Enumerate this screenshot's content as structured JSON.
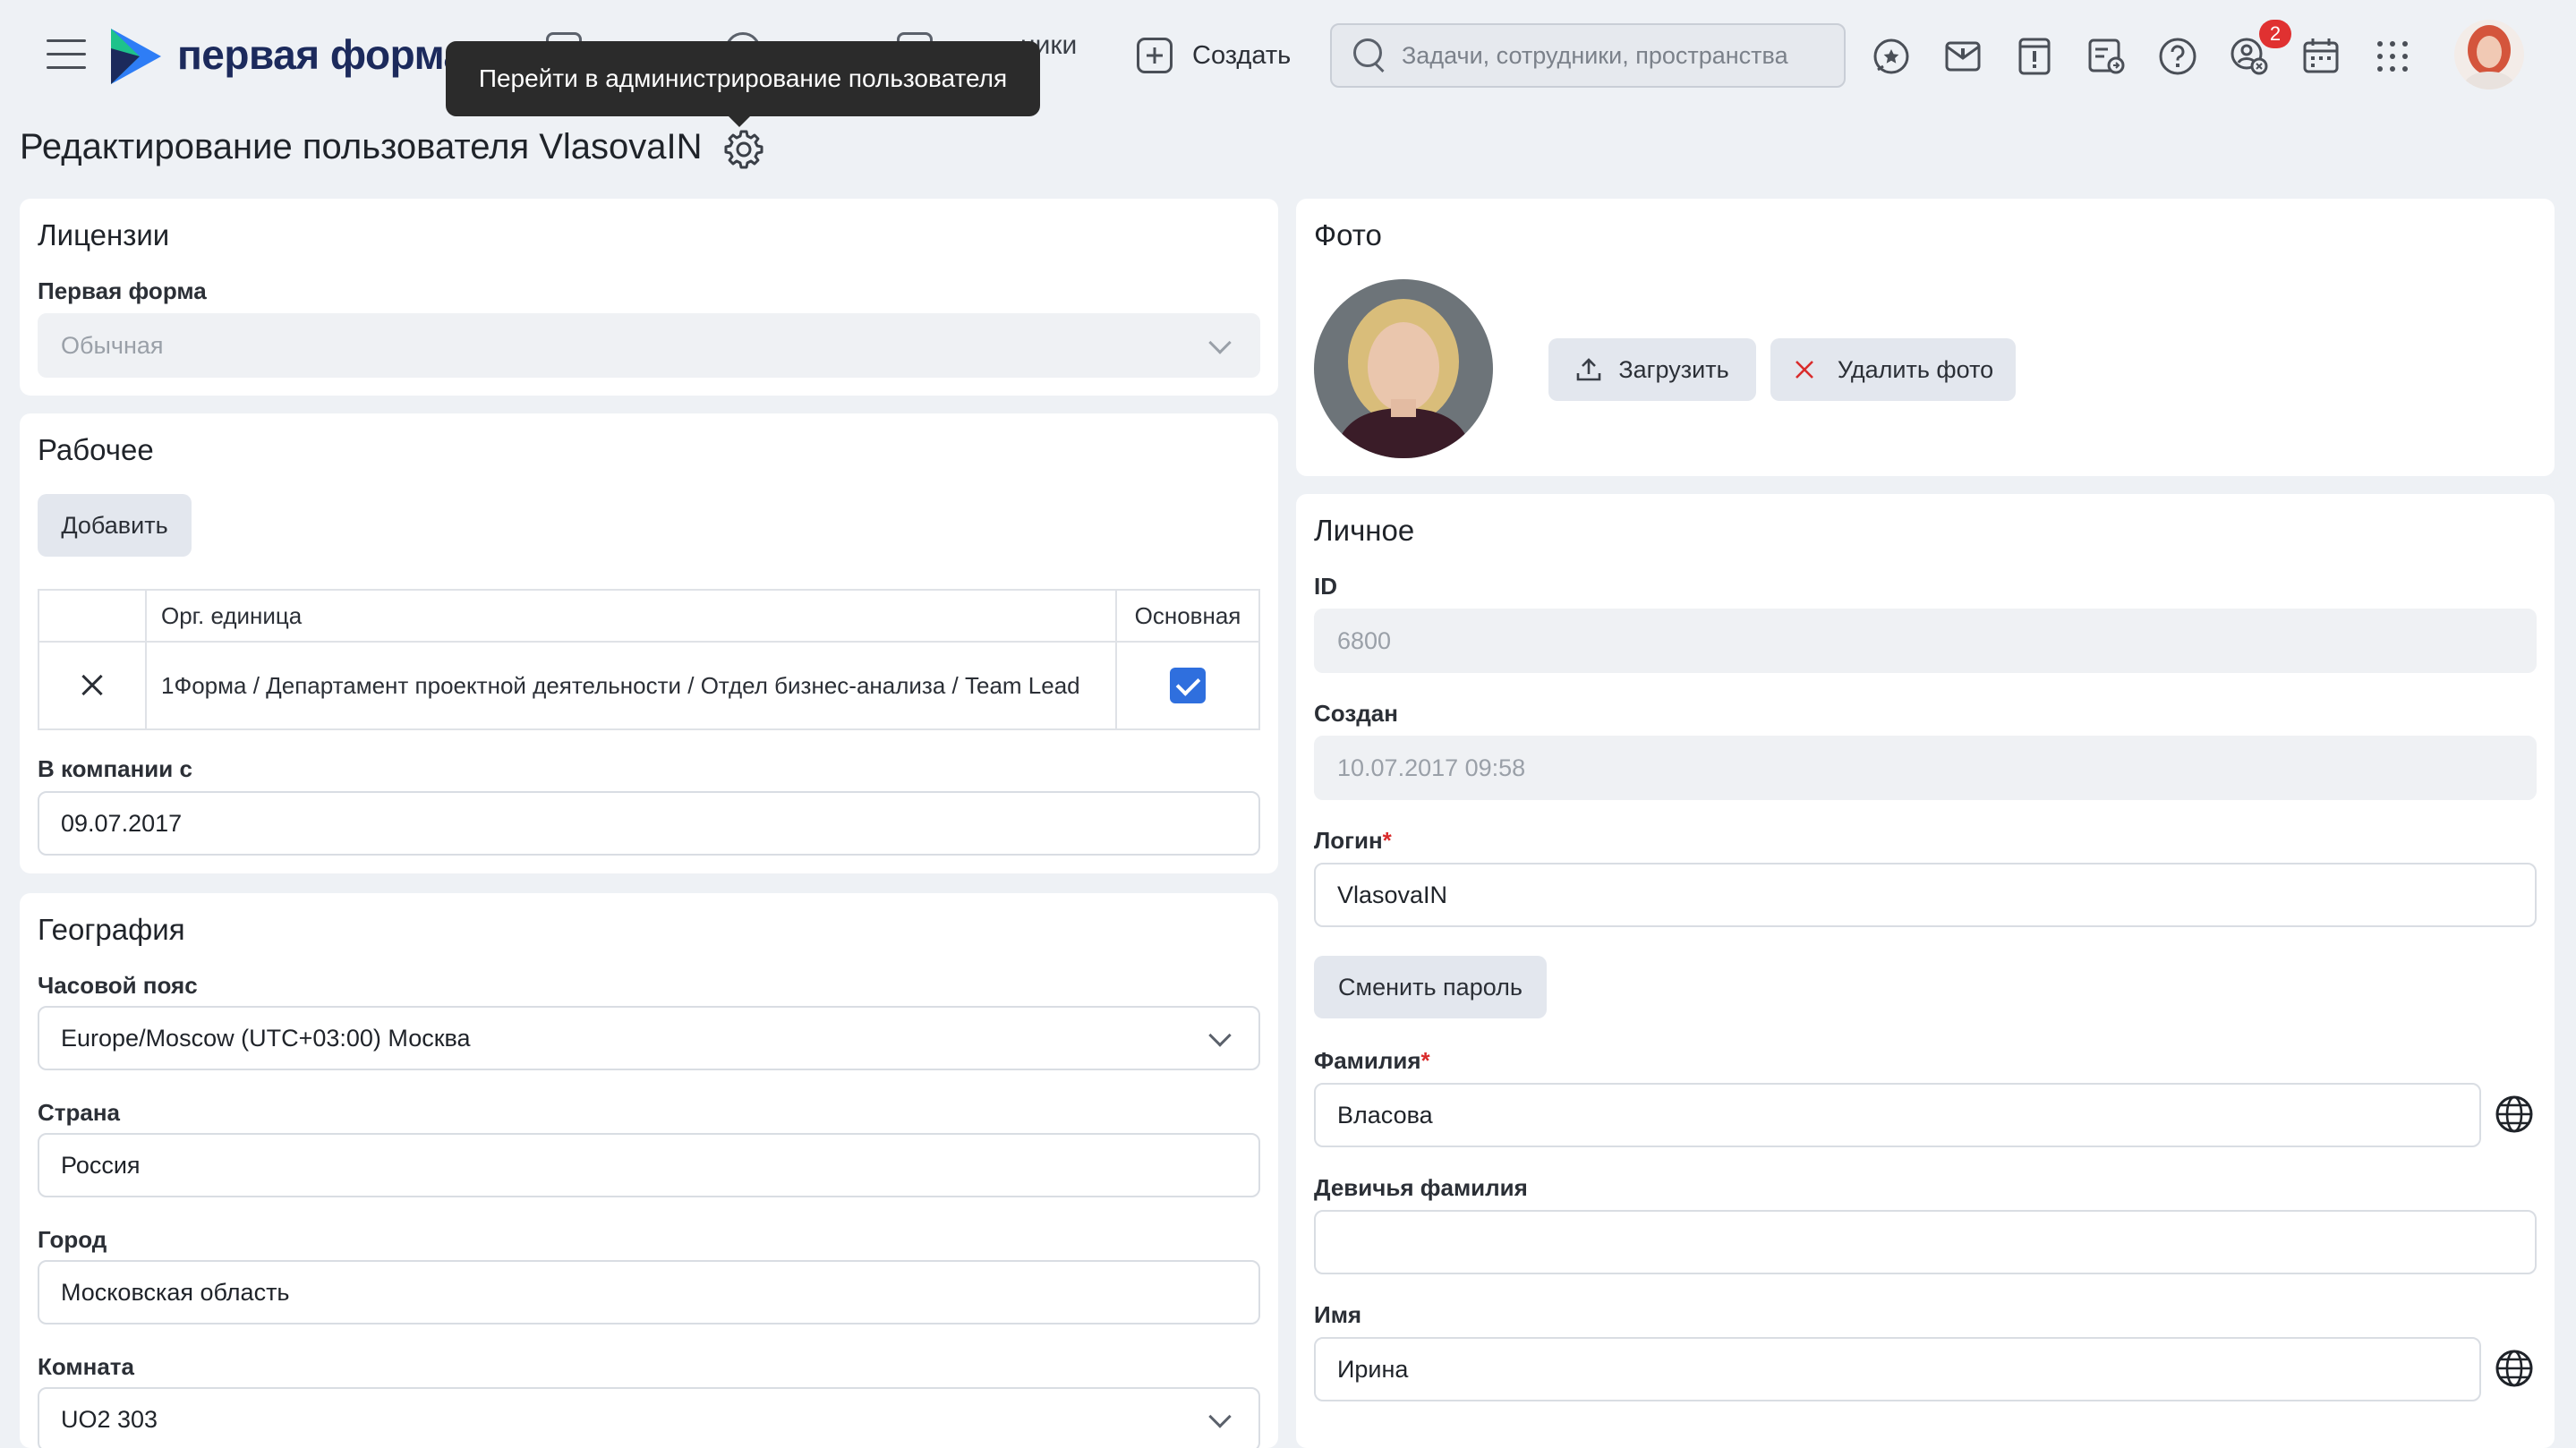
{
  "header": {
    "brand": "первая форма",
    "nav_partial": "ники",
    "create_label": "Создать",
    "search_placeholder": "Задачи, сотрудники, пространства",
    "notifications_badge": "2"
  },
  "tooltip": "Перейти в администрирование пользователя",
  "page_title": "Редактирование пользователя VlasovaIN",
  "licenses": {
    "title": "Лицензии",
    "label": "Первая форма",
    "value": "Обычная"
  },
  "work": {
    "title": "Рабочее",
    "add_button": "Добавить",
    "columns": [
      "",
      "Орг. единица",
      "Основная"
    ],
    "rows": [
      {
        "org_unit": "1Форма / Департамент проектной деятельности / Отдел бизнес-анализа / Team Lead",
        "primary": true
      }
    ],
    "since_label": "В компании с",
    "since_value": "09.07.2017"
  },
  "geo": {
    "title": "География",
    "timezone_label": "Часовой пояс",
    "timezone_value": "Europe/Moscow (UTC+03:00) Москва",
    "country_label": "Страна",
    "country_value": "Россия",
    "city_label": "Город",
    "city_value": "Московская область",
    "room_label": "Комната",
    "room_value": "UO2 303"
  },
  "photo": {
    "title": "Фото",
    "upload_button": "Загрузить",
    "delete_button": "Удалить фото"
  },
  "personal": {
    "title": "Личное",
    "id_label": "ID",
    "id_value": "6800",
    "created_label": "Создан",
    "created_value": "10.07.2017 09:58",
    "login_label": "Логин",
    "login_value": "VlasovaIN",
    "required_mark": "*",
    "change_password_button": "Сменить пароль",
    "lastname_label": "Фамилия",
    "lastname_value": "Власова",
    "maiden_label": "Девичья фамилия",
    "maiden_value": "",
    "firstname_label": "Имя",
    "firstname_value": "Ирина"
  },
  "colors": {
    "accent": "#2f6fde",
    "brand": "#1c2a5c",
    "badge": "#e03131",
    "required": "#d92b2b"
  }
}
